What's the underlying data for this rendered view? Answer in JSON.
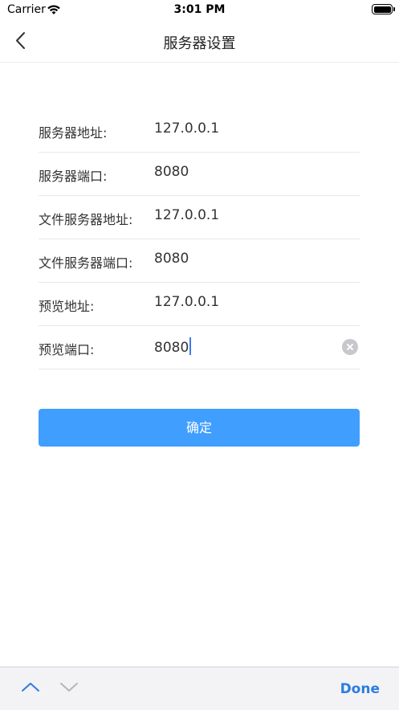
{
  "status_bar": {
    "carrier": "Carrier",
    "time": "3:01 PM"
  },
  "nav": {
    "title": "服务器设置",
    "back_icon": "chevron-left-icon"
  },
  "form": {
    "rows": [
      {
        "label": "服务器地址:",
        "value": "127.0.0.1"
      },
      {
        "label": "服务器端口:",
        "value": "8080"
      },
      {
        "label": "文件服务器地址:",
        "value": "127.0.0.1"
      },
      {
        "label": "文件服务器端口:",
        "value": "8080"
      },
      {
        "label": "预览地址:",
        "value": "127.0.0.1"
      },
      {
        "label": "预览端口:",
        "value": "8080"
      }
    ]
  },
  "confirm_label": "确定",
  "keyboard_bar": {
    "done_label": "Done",
    "prev_icon": "chevron-up-icon",
    "next_icon": "chevron-down-icon"
  },
  "colors": {
    "accent": "#409eff",
    "done": "#2a7de1",
    "cursor": "#3a7cf2"
  }
}
